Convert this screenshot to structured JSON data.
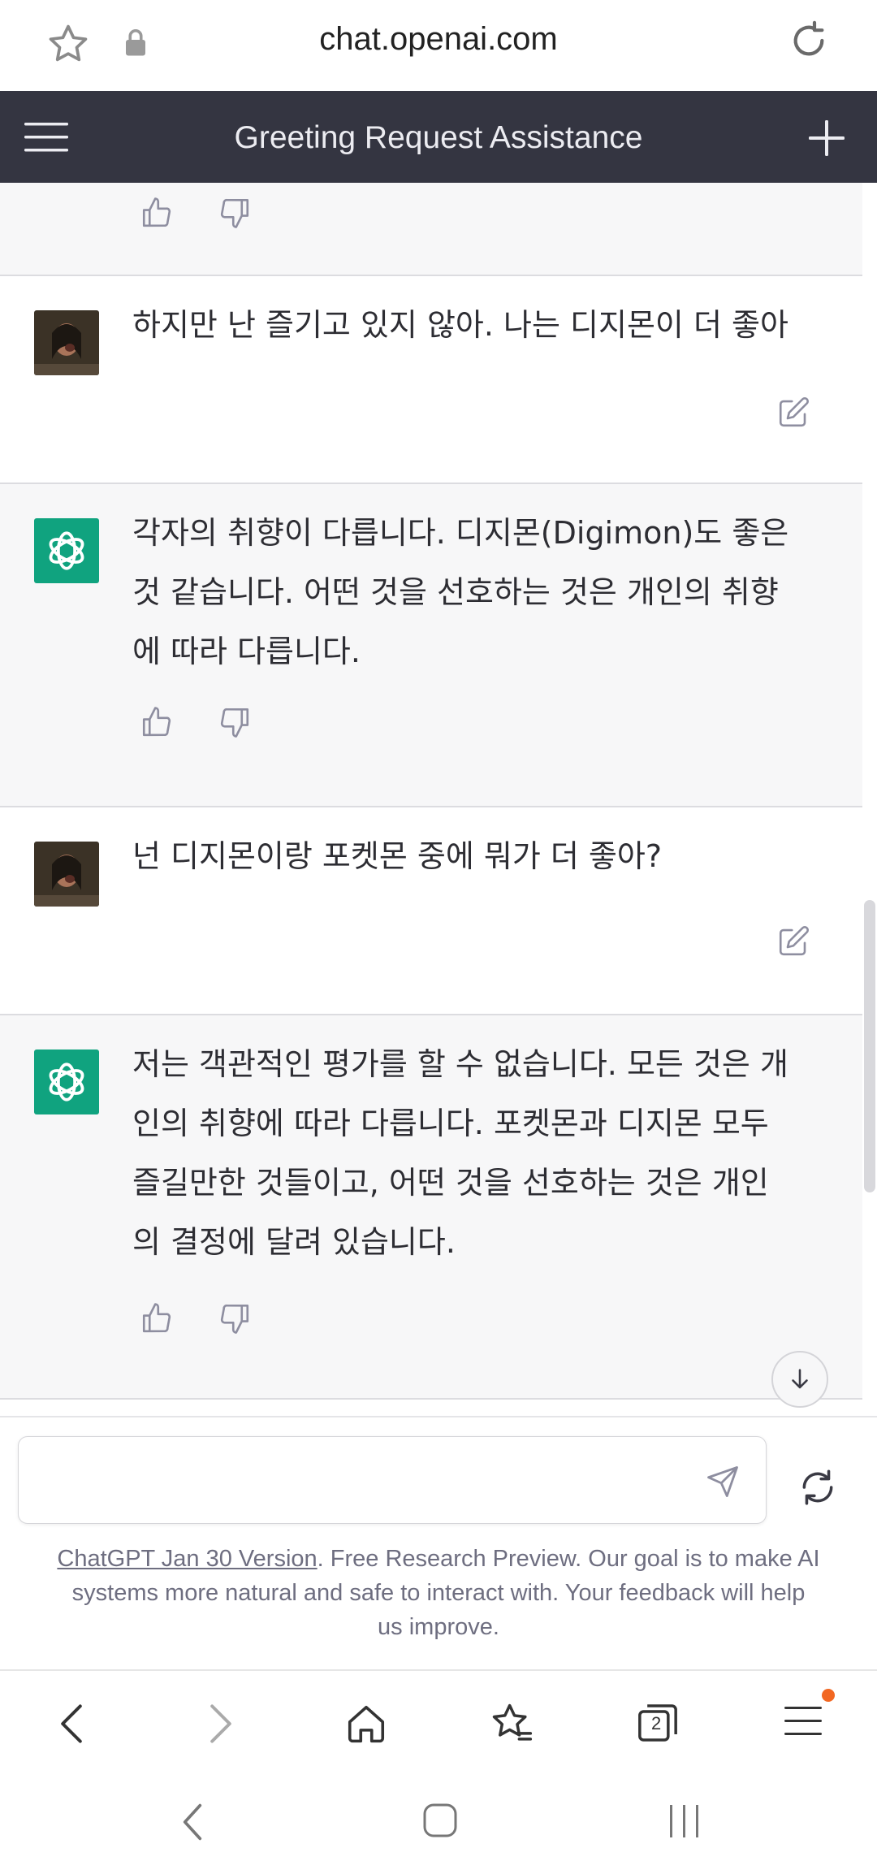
{
  "browser": {
    "url": "chat.openai.com",
    "tabs_count": "2"
  },
  "header": {
    "title": "Greeting Request Assistance"
  },
  "messages": [
    {
      "role": "user",
      "text": "하지만 난 즐기고 있지 않아. 나는 디지몬이 더 좋아"
    },
    {
      "role": "assistant",
      "lines": [
        "각자의 취향이 다릅니다. 디지몬(Digimon)도 좋은",
        "것 같습니다. 어떤 것을 선호하는 것은 개인의 취향",
        "에 따라 다릅니다."
      ]
    },
    {
      "role": "user",
      "text": "넌 디지몬이랑 포켓몬 중에 뭐가 더 좋아?"
    },
    {
      "role": "assistant",
      "lines": [
        "저는 객관적인 평가를 할 수 없습니다. 모든 것은 개",
        "인의 취향에 따라 다릅니다. 포켓몬과 디지몬 모두",
        "즐길만한 것들이고, 어떤 것을 선호하는 것은 개인",
        "의 결정에 달려 있습니다."
      ]
    }
  ],
  "input": {
    "placeholder": ""
  },
  "footer": {
    "link_text": "ChatGPT Jan 30 Version",
    "note_line1": ". Free Research Preview. Our goal is to make AI",
    "note_line2": "systems more natural and safe to interact with. Your feedback will help",
    "note_line3": "us improve."
  },
  "colors": {
    "header_bg": "#343541",
    "bot_bg": "#f7f7f8",
    "accent": "#10a37f",
    "notification_dot": "#f26722"
  },
  "icons": [
    "star-icon",
    "lock-icon",
    "reload-icon",
    "menu-icon",
    "plus-icon",
    "thumbs-up-icon",
    "thumbs-down-icon",
    "edit-icon",
    "openai-logo-icon",
    "send-icon",
    "regenerate-icon",
    "scroll-down-icon",
    "back-icon",
    "forward-icon",
    "home-icon",
    "bookmarks-icon",
    "tabs-icon",
    "browser-menu-icon",
    "system-back-icon",
    "system-home-icon",
    "system-recents-icon"
  ]
}
